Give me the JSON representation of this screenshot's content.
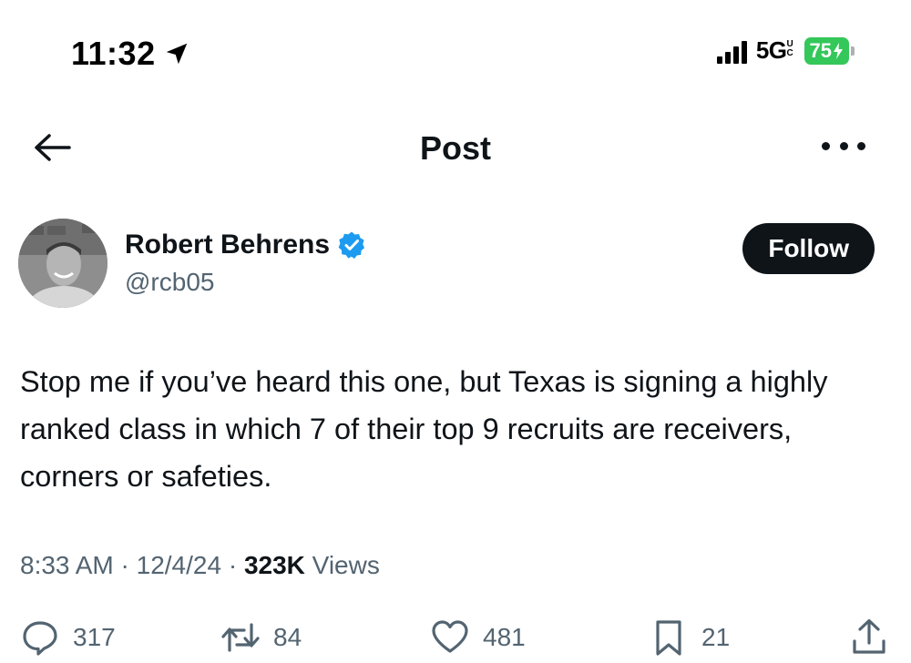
{
  "status_bar": {
    "time": "11:32",
    "network": "5G",
    "network_suffix": "UC",
    "battery": "75",
    "icons": [
      "location-arrow-icon",
      "signal-bars-icon",
      "battery-charging-icon"
    ]
  },
  "header": {
    "title": "Post",
    "back_icon": "arrow-left-icon",
    "more_icon": "more-horizontal-icon"
  },
  "author": {
    "name": "Robert Behrens",
    "handle": "@rcb05",
    "verified": true,
    "follow_label": "Follow"
  },
  "tweet": {
    "text": "Stop me if you’ve heard this one, but Texas is signing a highly ranked class in which 7 of their top 9 recruits are receivers, corners or safeties."
  },
  "meta": {
    "time": "8:33 AM",
    "separator": " · ",
    "date": "12/4/24",
    "views_count": "323K",
    "views_label": " Views"
  },
  "actions": {
    "replies": "317",
    "reposts": "84",
    "likes": "481",
    "bookmarks": "21"
  },
  "colors": {
    "text_primary": "#0f1419",
    "text_secondary": "#536471",
    "verified_blue": "#1d9bf0",
    "battery_green": "#34c759"
  }
}
